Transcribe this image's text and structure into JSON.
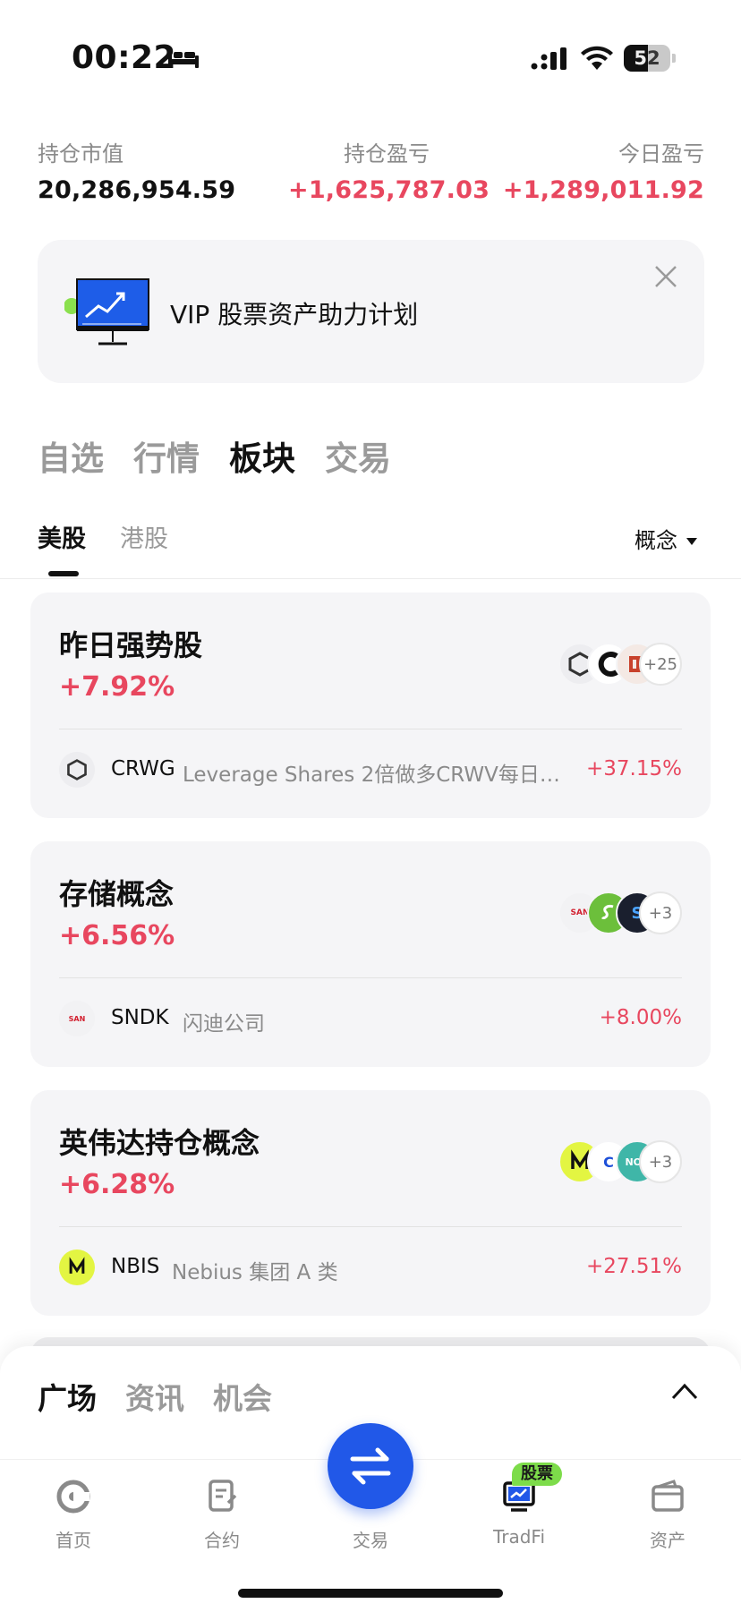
{
  "status_bar": {
    "time": "00:22",
    "battery": "52",
    "battery_level": 0.52
  },
  "summary": [
    {
      "label": "持仓市值",
      "value": "20,286,954.59"
    },
    {
      "label": "持仓盈亏",
      "value": "+1,625,787.03"
    },
    {
      "label": "今日盈亏",
      "value": "+1,289,011.92"
    }
  ],
  "banner": {
    "text": "VIP 股票资产助力计划"
  },
  "main_tabs": [
    "自选",
    "行情",
    "板块",
    "交易"
  ],
  "sub_tabs": [
    "美股",
    "港股"
  ],
  "filter": {
    "label": "概念"
  },
  "cards": [
    {
      "title": "昨日强势股",
      "change": "+7.92%",
      "more": "+25",
      "stock": {
        "ticker": "CRWG",
        "name": "Leverage Shares 2倍做多CRWV每日E...",
        "pct": "+37.15%"
      }
    },
    {
      "title": "存储概念",
      "change": "+6.56%",
      "more": "+3",
      "stock": {
        "ticker": "SNDK",
        "name": "闪迪公司",
        "pct": "+8.00%"
      }
    },
    {
      "title": "英伟达持仓概念",
      "change": "+6.28%",
      "more": "+3",
      "stock": {
        "ticker": "NBIS",
        "name": "Nebius 集团 A 类",
        "pct": "+27.51%"
      }
    }
  ],
  "sheet_tabs": [
    "广场",
    "资讯",
    "机会"
  ],
  "bottom_nav": [
    {
      "label": "首页",
      "icon": "home-icon"
    },
    {
      "label": "合约",
      "icon": "contract-icon"
    },
    {
      "label": "交易",
      "icon": "swap-icon"
    },
    {
      "label": "TradFi",
      "icon": "tradfi-icon",
      "badge": "股票"
    },
    {
      "label": "资产",
      "icon": "wallet-icon"
    }
  ],
  "colors": {
    "up": "#e8475f",
    "accent": "#2158e8",
    "badge": "#7ddc4a"
  }
}
